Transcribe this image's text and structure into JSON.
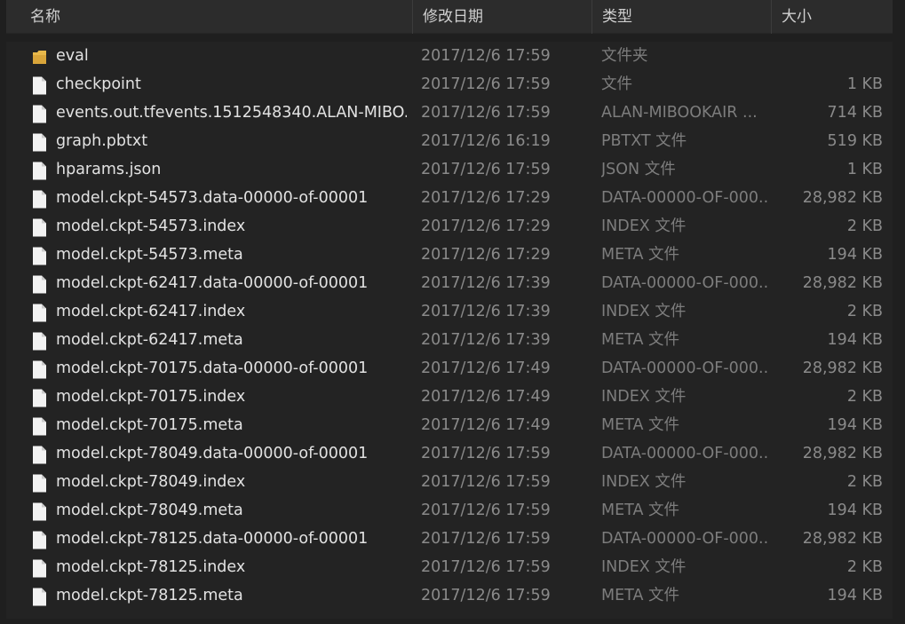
{
  "header": {
    "name_label": "名称",
    "date_label": "修改日期",
    "type_label": "类型",
    "size_label": "大小",
    "sort_glyph": "^"
  },
  "colors": {
    "folder": "#e8b84a",
    "file": "#f2f2f2",
    "background": "#232323",
    "header": "#2c2c2c"
  },
  "files": [
    {
      "icon": "folder-icon",
      "name": "eval",
      "date": "2017/12/6 17:59",
      "type": "文件夹",
      "size": ""
    },
    {
      "icon": "file-icon",
      "name": "checkpoint",
      "date": "2017/12/6 17:59",
      "type": "文件",
      "size": "1 KB"
    },
    {
      "icon": "file-icon",
      "name": "events.out.tfevents.1512548340.ALAN-MIBO...",
      "date": "2017/12/6 17:59",
      "type": "ALAN-MIBOOKAIR ...",
      "size": "714 KB"
    },
    {
      "icon": "file-icon",
      "name": "graph.pbtxt",
      "date": "2017/12/6 16:19",
      "type": "PBTXT 文件",
      "size": "519 KB"
    },
    {
      "icon": "file-icon",
      "name": "hparams.json",
      "date": "2017/12/6 17:59",
      "type": "JSON 文件",
      "size": "1 KB"
    },
    {
      "icon": "file-icon",
      "name": "model.ckpt-54573.data-00000-of-00001",
      "date": "2017/12/6 17:29",
      "type": "DATA-00000-OF-000...",
      "size": "28,982 KB"
    },
    {
      "icon": "file-icon",
      "name": "model.ckpt-54573.index",
      "date": "2017/12/6 17:29",
      "type": "INDEX 文件",
      "size": "2 KB"
    },
    {
      "icon": "file-icon",
      "name": "model.ckpt-54573.meta",
      "date": "2017/12/6 17:29",
      "type": "META 文件",
      "size": "194 KB"
    },
    {
      "icon": "file-icon",
      "name": "model.ckpt-62417.data-00000-of-00001",
      "date": "2017/12/6 17:39",
      "type": "DATA-00000-OF-000...",
      "size": "28,982 KB"
    },
    {
      "icon": "file-icon",
      "name": "model.ckpt-62417.index",
      "date": "2017/12/6 17:39",
      "type": "INDEX 文件",
      "size": "2 KB"
    },
    {
      "icon": "file-icon",
      "name": "model.ckpt-62417.meta",
      "date": "2017/12/6 17:39",
      "type": "META 文件",
      "size": "194 KB"
    },
    {
      "icon": "file-icon",
      "name": "model.ckpt-70175.data-00000-of-00001",
      "date": "2017/12/6 17:49",
      "type": "DATA-00000-OF-000...",
      "size": "28,982 KB"
    },
    {
      "icon": "file-icon",
      "name": "model.ckpt-70175.index",
      "date": "2017/12/6 17:49",
      "type": "INDEX 文件",
      "size": "2 KB"
    },
    {
      "icon": "file-icon",
      "name": "model.ckpt-70175.meta",
      "date": "2017/12/6 17:49",
      "type": "META 文件",
      "size": "194 KB"
    },
    {
      "icon": "file-icon",
      "name": "model.ckpt-78049.data-00000-of-00001",
      "date": "2017/12/6 17:59",
      "type": "DATA-00000-OF-000...",
      "size": "28,982 KB"
    },
    {
      "icon": "file-icon",
      "name": "model.ckpt-78049.index",
      "date": "2017/12/6 17:59",
      "type": "INDEX 文件",
      "size": "2 KB"
    },
    {
      "icon": "file-icon",
      "name": "model.ckpt-78049.meta",
      "date": "2017/12/6 17:59",
      "type": "META 文件",
      "size": "194 KB"
    },
    {
      "icon": "file-icon",
      "name": "model.ckpt-78125.data-00000-of-00001",
      "date": "2017/12/6 17:59",
      "type": "DATA-00000-OF-000...",
      "size": "28,982 KB"
    },
    {
      "icon": "file-icon",
      "name": "model.ckpt-78125.index",
      "date": "2017/12/6 17:59",
      "type": "INDEX 文件",
      "size": "2 KB"
    },
    {
      "icon": "file-icon",
      "name": "model.ckpt-78125.meta",
      "date": "2017/12/6 17:59",
      "type": "META 文件",
      "size": "194 KB"
    }
  ]
}
